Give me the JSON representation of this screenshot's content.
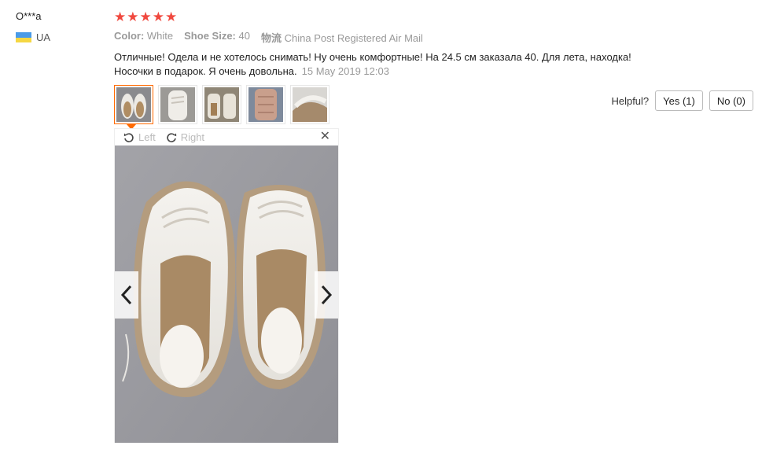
{
  "reviewer": {
    "name": "O***a",
    "country": "UA",
    "flag_colors": [
      "#4a9be8",
      "#f5d743"
    ]
  },
  "rating": {
    "stars": 5,
    "star_color": "#f0483e"
  },
  "attributes": [
    {
      "label": "Color:",
      "value": "White"
    },
    {
      "label": "Shoe Size:",
      "value": "40"
    },
    {
      "label": "物流",
      "value": "China Post Registered Air Mail"
    }
  ],
  "review": {
    "line1": "Отличные! Одела и не хотелось снимать! Ну очень комфортные! На 24.5 см заказала 40. Для лета, находка!",
    "line2": "Носочки в подарок. Я очень довольна.",
    "date": "15 May 2019 12:03"
  },
  "thumbnails": {
    "count": 5,
    "active_index": 0
  },
  "helpful": {
    "label": "Helpful?",
    "yes_label": "Yes (1)",
    "no_label": "No (0)"
  },
  "viewer": {
    "rotate_left_label": "Left",
    "rotate_right_label": "Right",
    "close_glyph": "✕"
  }
}
